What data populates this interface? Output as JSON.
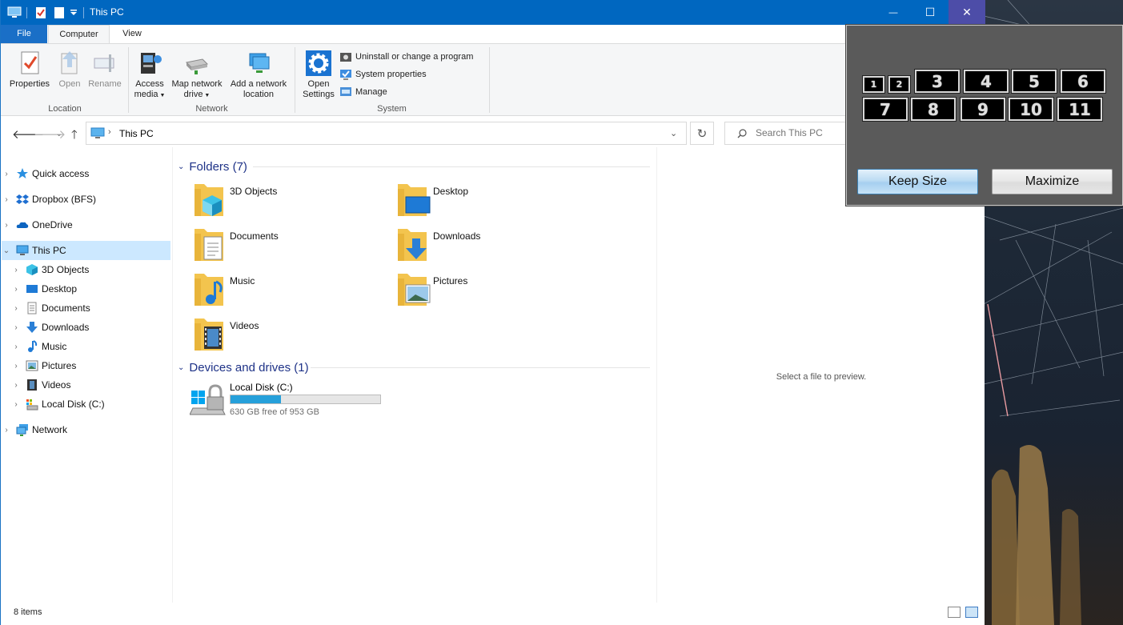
{
  "window": {
    "title": "This PC",
    "controls": {
      "minimize": "—",
      "maximize": "☐",
      "close": "✕"
    }
  },
  "ribbon_tabs": [
    "File",
    "Computer",
    "View"
  ],
  "ribbon": {
    "location": {
      "label": "Location",
      "properties": "Properties",
      "open": "Open",
      "rename": "Rename"
    },
    "network": {
      "label": "Network",
      "access_media_1": "Access",
      "access_media_2": "media",
      "map_drive_1": "Map network",
      "map_drive_2": "drive",
      "add_location_1": "Add a network",
      "add_location_2": "location"
    },
    "system": {
      "label": "System",
      "open_settings_1": "Open",
      "open_settings_2": "Settings",
      "uninstall": "Uninstall or change a program",
      "system_properties": "System properties",
      "manage": "Manage"
    }
  },
  "address": {
    "path": "This PC",
    "search_placeholder": "Search This PC"
  },
  "nav": {
    "quick_access": "Quick access",
    "dropbox": "Dropbox (BFS)",
    "onedrive": "OneDrive",
    "this_pc": "This PC",
    "children": [
      "3D Objects",
      "Desktop",
      "Documents",
      "Downloads",
      "Music",
      "Pictures",
      "Videos",
      "Local Disk (C:)"
    ],
    "network": "Network"
  },
  "content": {
    "folders_header": "Folders (7)",
    "folders": [
      "3D Objects",
      "Desktop",
      "Documents",
      "Downloads",
      "Music",
      "Pictures",
      "Videos"
    ],
    "devices_header": "Devices and drives (1)",
    "drive": {
      "name": "Local Disk (C:)",
      "free_text": "630 GB free of 953 GB",
      "used_fraction": 0.339
    }
  },
  "preview": {
    "empty_text": "Select a file to preview."
  },
  "status": {
    "item_count": "8 items"
  },
  "tool": {
    "cells": [
      "1",
      "2",
      "3",
      "4",
      "5",
      "6",
      "7",
      "8",
      "9",
      "10",
      "11"
    ],
    "keep_size": "Keep Size",
    "maximize": "Maximize"
  },
  "colors": {
    "titlebar": "#0067c0",
    "header_text": "#1e3287",
    "drive_fill": "#26a0da",
    "selection": "#cce8ff"
  }
}
